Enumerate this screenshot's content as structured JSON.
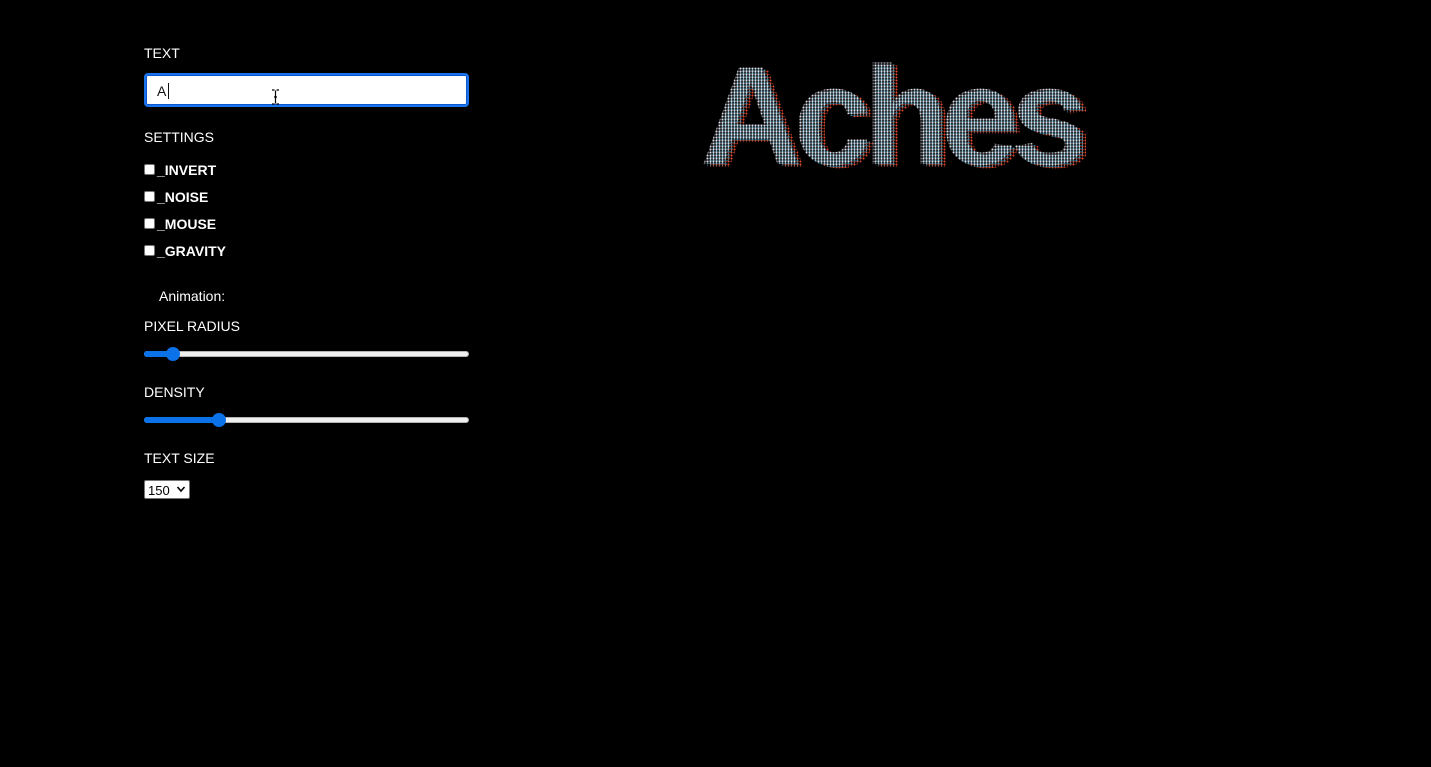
{
  "controls": {
    "text_label": "TEXT",
    "text_input_value": "A",
    "settings_label": "SETTINGS",
    "checkboxes": [
      {
        "label": "_INVERT",
        "checked": false
      },
      {
        "label": "_NOISE",
        "checked": false
      },
      {
        "label": "_MOUSE",
        "checked": false
      },
      {
        "label": "_GRAVITY",
        "checked": false
      }
    ],
    "animation_label": "Animation:",
    "pixel_radius_label": "PIXEL RADIUS",
    "pixel_radius_fraction": 0.07,
    "density_label": "DENSITY",
    "density_fraction": 0.22,
    "text_size_label": "TEXT SIZE",
    "text_size_value": "150"
  },
  "display": {
    "text": "Aches"
  },
  "colors": {
    "background": "#000000",
    "accent": "#0b72e9",
    "dot_primary": "#d9dde6",
    "dot_red": "#e0482a",
    "dot_blue": "#3f8aa8"
  },
  "icons": {
    "cursor": "i-beam-cursor-icon",
    "select_arrow": "chevron-down-icon"
  }
}
